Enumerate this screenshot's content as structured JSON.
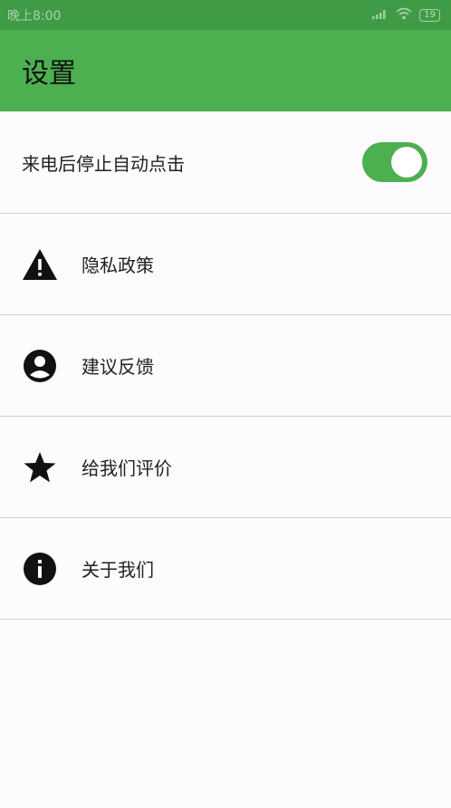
{
  "status_bar": {
    "time": "晚上8:00",
    "battery": "19"
  },
  "app_bar": {
    "title": "设置"
  },
  "settings": {
    "auto_click_toggle": {
      "label": "来电后停止自动点击",
      "state": "on"
    },
    "items": [
      {
        "label": "隐私政策",
        "icon": "warning-icon"
      },
      {
        "label": "建议反馈",
        "icon": "account-circle-icon"
      },
      {
        "label": "给我们评价",
        "icon": "star-icon"
      },
      {
        "label": "关于我们",
        "icon": "info-icon"
      }
    ]
  },
  "colors": {
    "status_bar": "#3f9b45",
    "app_bar": "#4caf50",
    "toggle_on": "#4caf50",
    "background": "#fdfbfd"
  }
}
